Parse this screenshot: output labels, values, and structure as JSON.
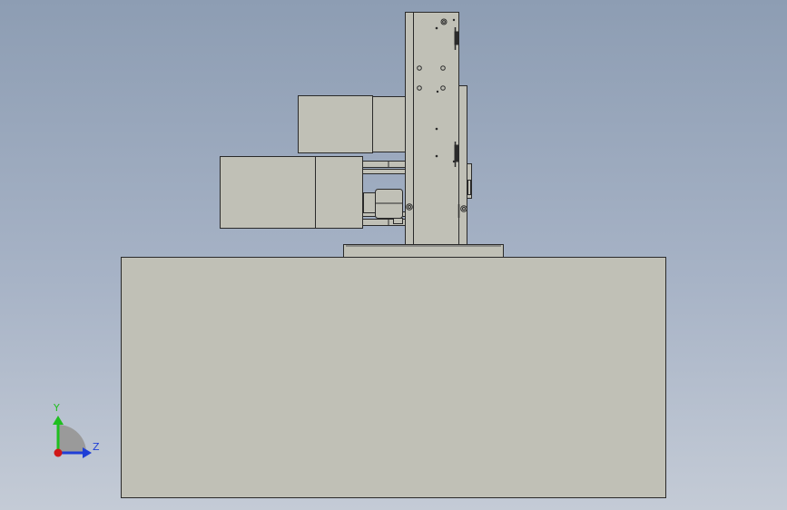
{
  "viewport": {
    "background_top": "#8d9db3",
    "background_bottom": "#c4cbd6",
    "model_face_color": "#c0c0b6",
    "edge_color": "#2a2a2a"
  },
  "triad": {
    "y_label": "Y",
    "z_label": "Z",
    "y_color": "#1fbf1f",
    "z_color": "#1f3fd6",
    "x_color": "#d01818"
  }
}
